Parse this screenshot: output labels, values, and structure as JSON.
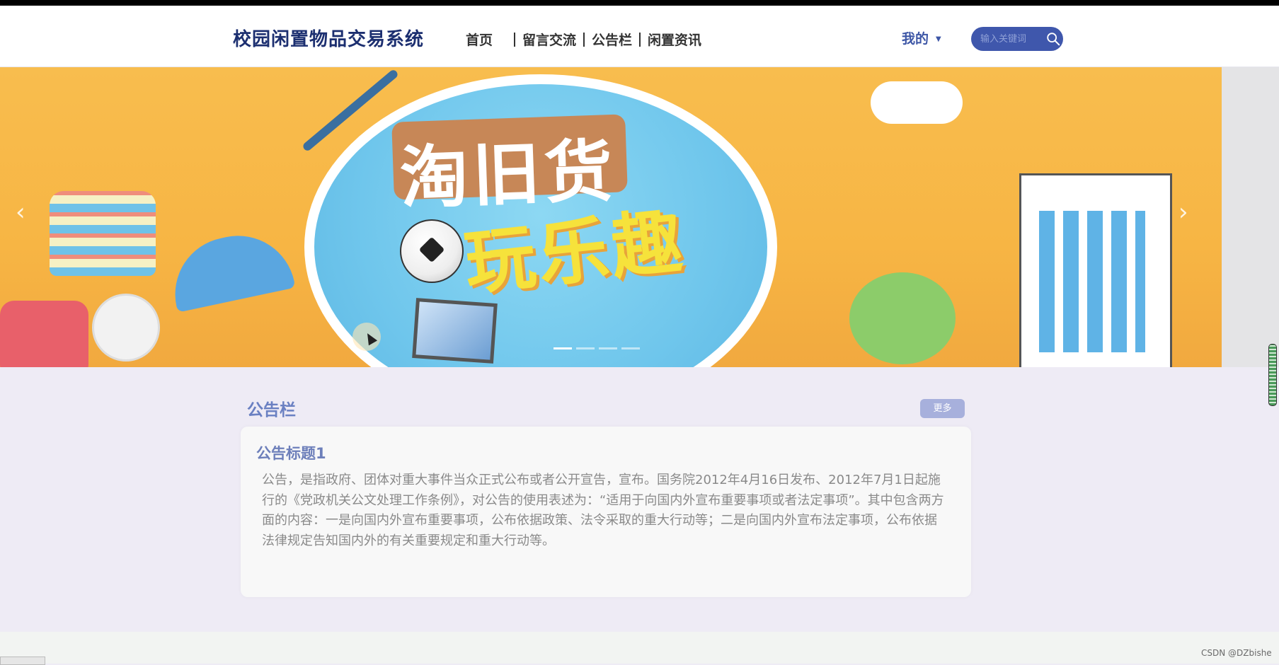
{
  "header": {
    "site_title": "校园闲置物品交易系统",
    "nav": [
      {
        "label": "首页"
      },
      {
        "label": "留言交流"
      },
      {
        "label": "公告栏"
      },
      {
        "label": "闲置资讯"
      }
    ],
    "user_menu_label": "我的",
    "search_placeholder": "输入关键词"
  },
  "banner": {
    "headline": "淘旧货",
    "subline": "玩乐趣",
    "slide_count": 4,
    "active_slide": 1,
    "prev_icon": "chevron-left-icon",
    "next_icon": "chevron-right-icon"
  },
  "notices": {
    "section_title": "公告栏",
    "more_label": "更多",
    "items": [
      {
        "title": "公告标题1",
        "body": "公告，是指政府、团体对重大事件当众正式公布或者公开宣告，宣布。国务院2012年4月16日发布、2012年7月1日起施行的《党政机关公文处理工作条例》，对公告的使用表述为：“适用于向国内外宣布重要事项或者法定事项”。其中包含两方面的内容：一是向国内外宣布重要事项，公布依据政策、法令采取的重大行动等；二是向国内外宣布法定事项，公布依据法律规定告知国内外的有关重要规定和重大行动等。"
      }
    ]
  },
  "watermark": "CSDN @DZbishe",
  "colors": {
    "title": "#1c2f70",
    "accent": "#3f57ac",
    "section_title": "#6a80c2",
    "more_button": "#a7b0dc"
  }
}
